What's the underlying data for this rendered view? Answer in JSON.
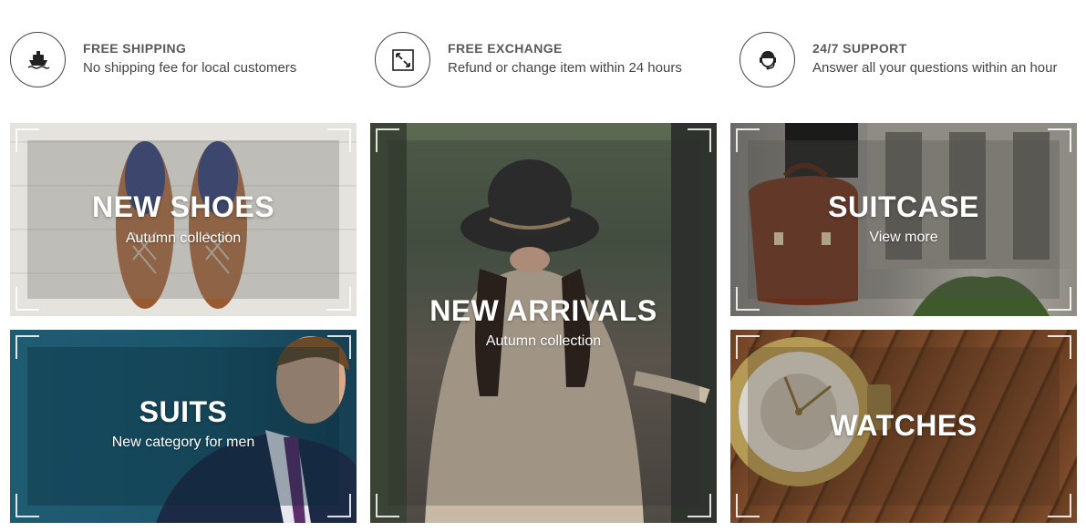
{
  "features": [
    {
      "icon": "ship-icon",
      "title": "FREE SHIPPING",
      "description": "No shipping fee for local customers"
    },
    {
      "icon": "exchange-arrows-icon",
      "title": "FREE EXCHANGE",
      "description": "Refund or change item within 24 hours"
    },
    {
      "icon": "headset-support-icon",
      "title": "24/7 SUPPORT",
      "description": "Answer all your questions within an hour"
    }
  ],
  "banners": {
    "shoes": {
      "title": "NEW SHOES",
      "subtitle": "Autumn collection"
    },
    "suits": {
      "title": "SUITS",
      "subtitle": "New category for men"
    },
    "arrivals": {
      "title": "NEW ARRIVALS",
      "subtitle": "Autumn collection"
    },
    "suitcase": {
      "title": "SUITCASE",
      "subtitle": "View more"
    },
    "watches": {
      "title": "WATCHES",
      "subtitle": ""
    }
  },
  "colors": {
    "text_dark": "#444444",
    "title_gray": "#595959",
    "overlay_text": "#ffffff"
  }
}
